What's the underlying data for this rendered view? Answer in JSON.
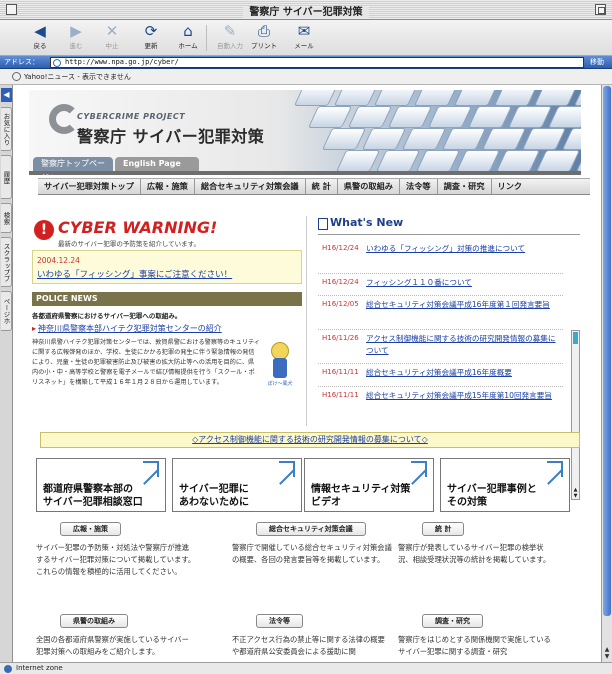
{
  "window": {
    "title": "警察庁 サイバー犯罪対策"
  },
  "toolbar": [
    {
      "label": "戻る",
      "icon": "back-icon",
      "glyph": "◀",
      "enabled": true
    },
    {
      "label": "進む",
      "icon": "forward-icon",
      "glyph": "▶",
      "enabled": false
    },
    {
      "label": "中止",
      "icon": "stop-icon",
      "glyph": "✕",
      "enabled": false
    },
    {
      "label": "更新",
      "icon": "refresh-icon",
      "glyph": "⟳",
      "enabled": true
    },
    {
      "label": "ホーム",
      "icon": "home-icon",
      "glyph": "⌂",
      "enabled": true
    },
    {
      "label": "自動入力",
      "icon": "autofill-icon",
      "glyph": "✎",
      "enabled": false
    },
    {
      "label": "プリント",
      "icon": "print-icon",
      "glyph": "⎙",
      "enabled": true
    },
    {
      "label": "メール",
      "icon": "mail-icon",
      "glyph": "✉",
      "enabled": true
    }
  ],
  "address": {
    "label": "アドレス：",
    "url": "http://www.npa.go.jp/cyber/",
    "go": "移動"
  },
  "favorites": {
    "item": "Yahoo!ニュース - 表示できません"
  },
  "sidetabs": [
    "お気に入り",
    "履歴",
    "検索",
    "スクラップブック",
    "ページホルダ"
  ],
  "header": {
    "project": "CYBERCRIME PROJECT",
    "title": "警察庁 サイバー犯罪対策",
    "tab_top": "警察庁トップページへ",
    "tab_english": "English Page"
  },
  "nav": [
    "サイバー犯罪対策トップ",
    "広報・施策",
    "総合セキュリティ対策会議",
    "統 計",
    "県警の取組み",
    "法令等",
    "調査・研究",
    "リンク"
  ],
  "warning": {
    "title": "CYBER WARNING!",
    "subtitle": "最新のサイバー犯罪の予防策を紹介しています。",
    "date": "2004.12.24",
    "link": "いわゆる「フィッシング」事案にご注意ください！"
  },
  "police": {
    "heading": "POLICE NEWS",
    "sub": "各都道府県警察におけるサイバー犯罪への取組み。",
    "link": "神奈川県警察本部ハイテク犯罪対策センターの紹介",
    "body": "神奈川県警ハイテク犯罪対策センターでは、敦賀県警における警察等のキュリティに関する広報啓発のほか、学校、生徒にかかる犯罪の発生に伴う緊急情報の発信により、児童・生徒の犯罪被害防止及び被害の拡大防止等への活用を目的に、県内の小・中・高等学校と警察を電子メールで結び情報提供を行う「スクール・ポリスネット」を構築して平成１６年１月２８日から運用しています。",
    "mascot_label": "ぽけ〜風犬"
  },
  "whats_new": {
    "heading": "What's New",
    "items": [
      {
        "date": "H16/12/24",
        "text": "いわゆる「フィッシング」対策の推進について"
      },
      {
        "date": "H16/12/24",
        "text": "フィッシング１１０番について"
      },
      {
        "date": "H16/12/05",
        "text": "総合セキュリティ対策会議平成16年度第１回発言要旨"
      },
      {
        "date": "H16/11/26",
        "text": "アクセス制御機能に関する技術の研究開発情報の募集について"
      },
      {
        "date": "H16/11/11",
        "text": "総合セキュリティ対策会議平成16年度概要"
      },
      {
        "date": "H16/11/11",
        "text": "総合セキュリティ対策会議平成15年度第10回発言要旨"
      }
    ]
  },
  "access_banner": "◇アクセス制御機能に関する技術の研究開発情報の募集について◇",
  "big_links": [
    "都道府県警察本部の\nサイバー犯罪相談窓口",
    "サイバー犯罪に\nあわないために",
    "情報セキュリティ対策\nビデオ",
    "サイバー犯罪事例と\nその対策"
  ],
  "sections": [
    {
      "title": "広報・施策",
      "text": "サイバー犯罪の予防策・対処法や警察庁が推進するサイバー犯罪対策について掲載しています。これらの情報を積極的に活用してください。"
    },
    {
      "title": "総合セキュリティ対策会議",
      "text": "警察庁で開催している総合セキュリティ対策会議の概要、各回の発言要旨等を掲載しています。"
    },
    {
      "title": "統 計",
      "text": "警察庁が発表しているサイバー犯罪の検挙状況、相談受理状況等の統計を掲載しています。"
    },
    {
      "title": "県警の取組み",
      "text": "全国の各都道府県警察が実施しているサイバー犯罪対策への取組みをご紹介します。"
    },
    {
      "title": "法令等",
      "text": "不正アクセス行為の禁止等に関する法律の概要や都道府県公安委員会による援助に関"
    },
    {
      "title": "調査・研究",
      "text": "警察庁をはじめとする関係機関で実施しているサイバー犯罪に関する調査・研究"
    }
  ],
  "status": {
    "text": "Internet zone"
  },
  "colors": {
    "accent": "#1a3fa8",
    "warning": "#d22020",
    "police_bar": "#7a7248",
    "address_bar": "#2d5fb0"
  }
}
